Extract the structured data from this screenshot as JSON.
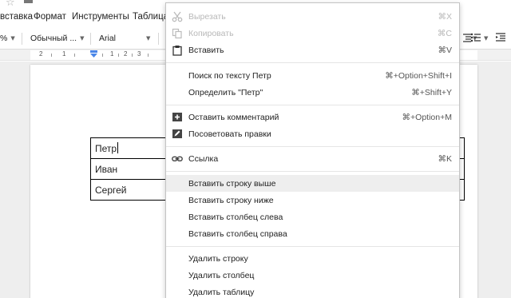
{
  "menubar": {
    "items": [
      "вставка",
      "Формат",
      "Инструменты",
      "Таблица"
    ]
  },
  "toolbar": {
    "zoom_suffix": "%",
    "style": "Обычный ...",
    "font": "Arial"
  },
  "ruler": {
    "numbers": [
      "2",
      "1",
      "1",
      "2",
      "3"
    ]
  },
  "document": {
    "table_rows": [
      "Петр",
      "Иван",
      "Сергей"
    ]
  },
  "context_menu": {
    "items": [
      {
        "label": "Вырезать",
        "shortcut": "⌘X",
        "icon": "scissors-icon",
        "disabled": true
      },
      {
        "label": "Копировать",
        "shortcut": "⌘C",
        "icon": "copy-icon",
        "disabled": true
      },
      {
        "label": "Вставить",
        "shortcut": "⌘V",
        "icon": "paste-icon",
        "disabled": false
      },
      {
        "label": "Поиск по тексту Петр",
        "shortcut": "⌘+Option+Shift+I",
        "icon": "",
        "disabled": false
      },
      {
        "label": "Определить \"Петр\"",
        "shortcut": "⌘+Shift+Y",
        "icon": "",
        "disabled": false
      },
      {
        "label": "Оставить комментарий",
        "shortcut": "⌘+Option+M",
        "icon": "add-comment-icon",
        "disabled": false
      },
      {
        "label": "Посоветовать правки",
        "shortcut": "",
        "icon": "suggest-edits-icon",
        "disabled": false
      },
      {
        "label": "Ссылка",
        "shortcut": "⌘K",
        "icon": "link-icon",
        "disabled": false
      },
      {
        "label": "Вставить строку выше",
        "shortcut": "",
        "icon": "",
        "disabled": false,
        "highlighted": true
      },
      {
        "label": "Вставить строку ниже",
        "shortcut": "",
        "icon": "",
        "disabled": false
      },
      {
        "label": "Вставить столбец слева",
        "shortcut": "",
        "icon": "",
        "disabled": false
      },
      {
        "label": "Вставить столбец справа",
        "shortcut": "",
        "icon": "",
        "disabled": false
      },
      {
        "label": "Удалить строку",
        "shortcut": "",
        "icon": "",
        "disabled": false
      },
      {
        "label": "Удалить столбец",
        "shortcut": "",
        "icon": "",
        "disabled": false
      },
      {
        "label": "Удалить таблицу",
        "shortcut": "",
        "icon": "",
        "disabled": false
      }
    ]
  },
  "colors": {
    "highlight": "#eeeeee",
    "disabled_text": "#b8b8b8",
    "ruler_marker": "#4a86e8"
  }
}
